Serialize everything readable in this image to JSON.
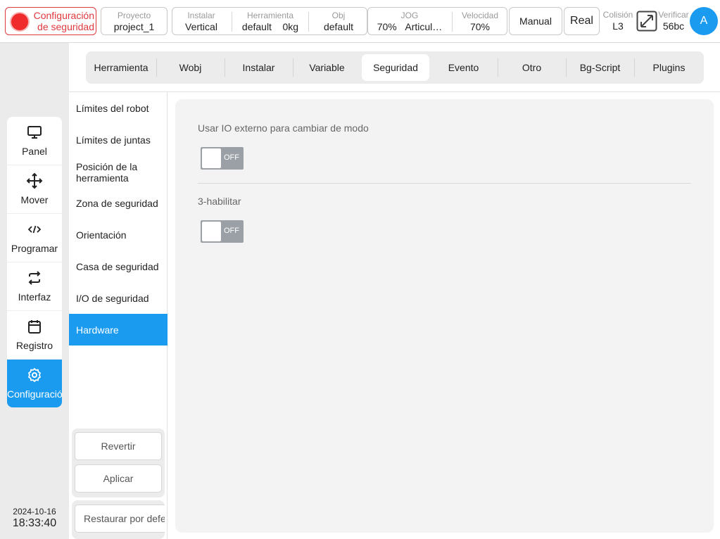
{
  "topbar": {
    "safety_label_line1": "Configuración",
    "safety_label_line2": "de seguridad",
    "project_label": "Proyecto",
    "project_value": "project_1",
    "install_label": "Instalar",
    "install_value": "Vertical",
    "tool_label": "Herramienta",
    "tool_value": "default",
    "tool_payload": "0kg",
    "obj_label": "Obj",
    "obj_value": "default",
    "jog_label": "JOG",
    "jog_value": "70%",
    "jog_mode": "Articul…",
    "speed_label": "Velocidad",
    "speed_value": "70%",
    "manual_button": "Manual",
    "real_button": "Real",
    "collision_label": "Colisión",
    "collision_value": "L3",
    "verify_label": "Verificar",
    "verify_value": "56bc",
    "avatar_letter": "A",
    "colors": {
      "safety_red": "#ef2b2b",
      "accent": "#1a9bf0"
    }
  },
  "leftnav": {
    "items": [
      {
        "label": "Panel",
        "icon": "monitor-icon"
      },
      {
        "label": "Mover",
        "icon": "move-arrows-icon"
      },
      {
        "label": "Programar",
        "icon": "code-icon"
      },
      {
        "label": "Interfaz",
        "icon": "swap-arrows-icon"
      },
      {
        "label": "Registro",
        "icon": "calendar-icon"
      },
      {
        "label": "Configuración",
        "icon": "gear-icon",
        "active": true
      }
    ],
    "date": "2024-10-16",
    "time": "18:33:40"
  },
  "tabs": [
    {
      "label": "Herramienta"
    },
    {
      "label": "Wobj"
    },
    {
      "label": "Instalar"
    },
    {
      "label": "Variable"
    },
    {
      "label": "Seguridad",
      "active": true
    },
    {
      "label": "Evento"
    },
    {
      "label": "Otro"
    },
    {
      "label": "Bg-Script"
    },
    {
      "label": "Plugins"
    }
  ],
  "submenu": {
    "items": [
      {
        "label": "Límites del robot"
      },
      {
        "label": "Límites de juntas"
      },
      {
        "label": "Posición de la herramienta"
      },
      {
        "label": "Zona de seguridad"
      },
      {
        "label": "Orientación"
      },
      {
        "label": "Casa de seguridad"
      },
      {
        "label": "I/O de seguridad"
      },
      {
        "label": "Hardware",
        "active": true
      }
    ],
    "revert_button": "Revertir",
    "apply_button": "Aplicar",
    "restore_button": "Restaurar por defecto"
  },
  "content": {
    "external_io_label": "Usar IO externo para cambiar de modo",
    "external_io_state": "OFF",
    "three_enable_label": "3-habilitar",
    "three_enable_state": "OFF"
  }
}
